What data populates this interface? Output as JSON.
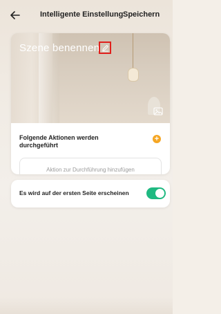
{
  "header": {
    "title": "Intelligente Einstellung",
    "save_label": "Speichern"
  },
  "scene": {
    "name": "Szene benennen",
    "edit_icon": "pencil-icon",
    "image_icon": "image-icon"
  },
  "actions": {
    "title": "Folgende Aktionen werden durchgeführt",
    "add_icon": "plus-icon",
    "add_label": "Aktion zur Durchführung hinzufügen"
  },
  "first_page": {
    "label": "Es wird auf der ersten Seite erscheinen",
    "enabled": true
  },
  "colors": {
    "accent_green": "#1fb981",
    "add_orange": "#f5a623",
    "highlight_red": "#e0201c"
  }
}
